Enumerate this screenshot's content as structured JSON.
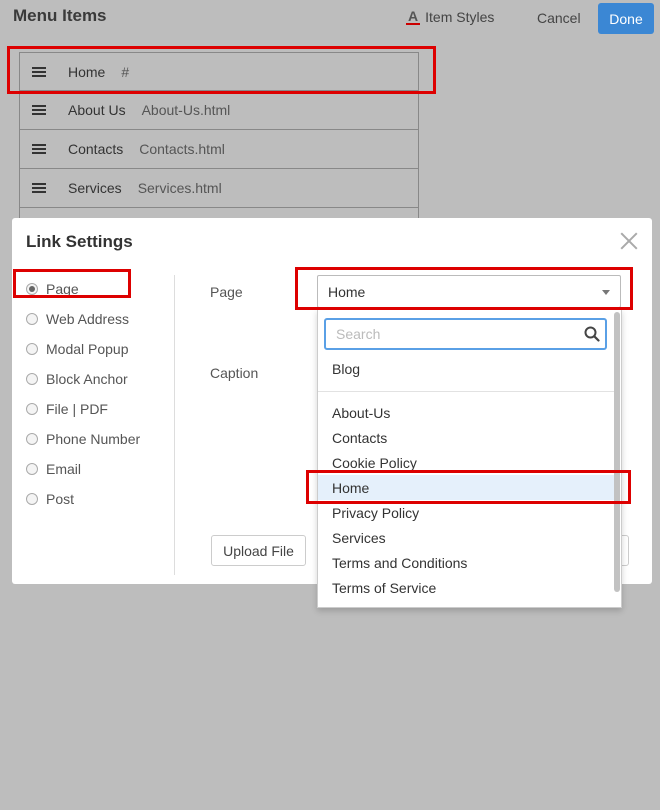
{
  "header": {
    "title": "Menu Items",
    "item_styles_label": "Item Styles",
    "item_styles_icon_glyph": "A",
    "cancel_label": "Cancel",
    "done_label": "Done",
    "accent_color": "#3b87d4"
  },
  "menu_items": [
    {
      "caption": "Home",
      "url": "#"
    },
    {
      "caption": "About Us",
      "url": "About-Us.html"
    },
    {
      "caption": "Contacts",
      "url": "Contacts.html"
    },
    {
      "caption": "Services",
      "url": "Services.html"
    }
  ],
  "modal": {
    "title": "Link Settings",
    "link_types": [
      {
        "label": "Page",
        "checked": true
      },
      {
        "label": "Web Address",
        "checked": false
      },
      {
        "label": "Modal Popup",
        "checked": false
      },
      {
        "label": "Block Anchor",
        "checked": false
      },
      {
        "label": "File | PDF",
        "checked": false
      },
      {
        "label": "Phone Number",
        "checked": false
      },
      {
        "label": "Email",
        "checked": false
      },
      {
        "label": "Post",
        "checked": false
      }
    ],
    "page_label": "Page",
    "page_value": "Home",
    "caption_label": "Caption",
    "upload_label": "Upload File"
  },
  "dropdown": {
    "search_placeholder": "Search",
    "top_item": "Blog",
    "items": [
      "About-Us",
      "Contacts",
      "Cookie Policy",
      "Home",
      "Privacy Policy",
      "Services",
      "Terms and Conditions",
      "Terms of Service"
    ],
    "selected": "Home",
    "highlight_color": "#dd0000"
  }
}
